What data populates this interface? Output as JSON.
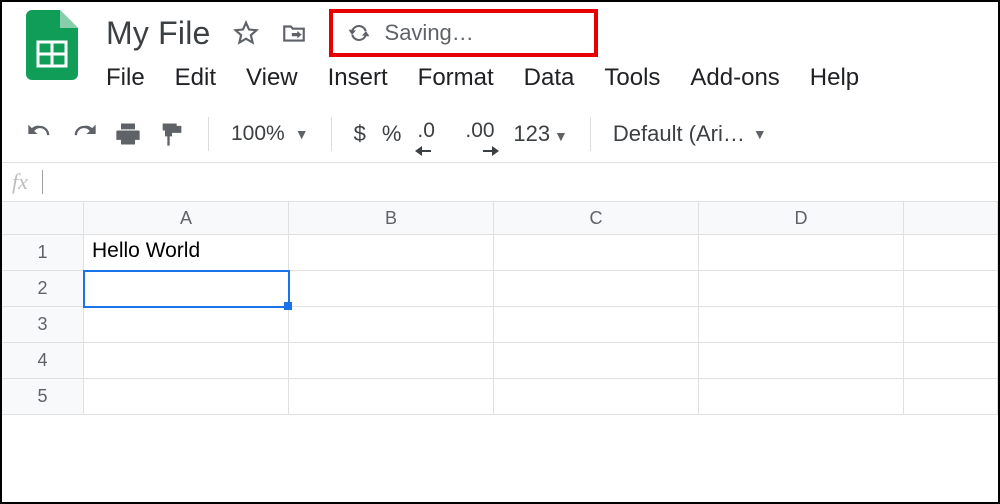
{
  "doc": {
    "title": "My File",
    "saving_label": "Saving…"
  },
  "menus": [
    "File",
    "Edit",
    "View",
    "Insert",
    "Format",
    "Data",
    "Tools",
    "Add-ons",
    "Help"
  ],
  "toolbar": {
    "zoom": "100%",
    "currency": "$",
    "percent": "%",
    "dec_decrease": ".0",
    "dec_increase": ".00",
    "number_format": "123",
    "font": "Default (Ari…"
  },
  "fx": {
    "label": "fx",
    "value": ""
  },
  "grid": {
    "columns": [
      "A",
      "B",
      "C",
      "D"
    ],
    "rows": [
      {
        "n": "1",
        "cells": [
          "Hello World",
          "",
          "",
          ""
        ]
      },
      {
        "n": "2",
        "cells": [
          "",
          "",
          "",
          ""
        ]
      },
      {
        "n": "3",
        "cells": [
          "",
          "",
          "",
          ""
        ]
      },
      {
        "n": "4",
        "cells": [
          "",
          "",
          "",
          ""
        ]
      },
      {
        "n": "5",
        "cells": [
          "",
          "",
          "",
          ""
        ]
      }
    ],
    "selected": {
      "row": 1,
      "col": 0
    }
  }
}
